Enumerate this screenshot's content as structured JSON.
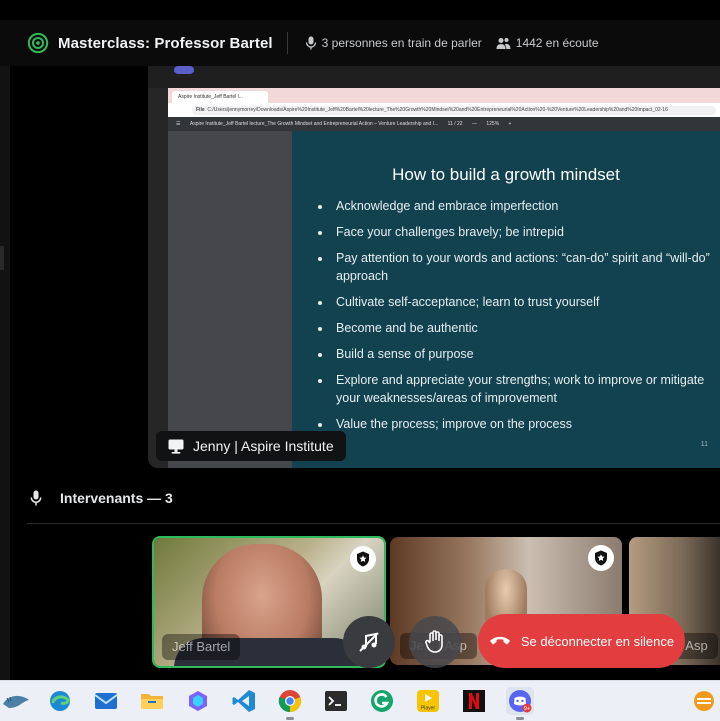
{
  "header": {
    "title": "Masterclass: Professor Bartel",
    "speaking_status": "3 personnes en train de parler",
    "listeners": "1442 en écoute"
  },
  "stream": {
    "browser_tab": "Aspire Institute_Jeff Bartel l...",
    "address_prefix": "File",
    "address": "C:/Users/jennymorrey/Downloads/Aspire%20Institute_Jeff%20Bartel%20lecture_The%20Growth%20Mindset%20and%20Entrepreneurial%20Action%20-%20Venture%20Leadership%20and%20Impact_02-16",
    "pdf_title": "Aspire Institute_Jeff Bartel lecture_The Growth Mindset and Entrepreneurial Action – Venture Leadership and I...",
    "pdf_page": "11 / 22",
    "pdf_zoom": "125%",
    "slide": {
      "title": "How to build a growth mindset",
      "bullets": [
        "Acknowledge and embrace imperfection",
        "Face your challenges bravely; be intrepid",
        "Pay attention to your words and actions: “can-do” spirit and “will-do” approach",
        "Cultivate self-acceptance; learn to trust yourself",
        "Become and be authentic",
        "Build a sense of purpose",
        "Explore and appreciate your strengths; work to improve or mitigate your weaknesses/areas of improvement",
        "Value the process; improve on the process"
      ],
      "page_number": "11"
    },
    "presenter": "Jenny | Aspire Institute"
  },
  "speakers_section": {
    "label": "Intervenants — 3"
  },
  "tiles": [
    {
      "name": "Jeff Bartel"
    },
    {
      "name": "Je... | Asp"
    },
    {
      "name": "| Asp"
    }
  ],
  "controls": {
    "leave_label": "Se déconnecter en silence"
  },
  "taskbar": {
    "player_label": "Player",
    "notif_badge": "9+"
  },
  "colors": {
    "live_green": "#2dbb5d",
    "leave_red": "#e23d3f",
    "slide_bg": "#12424f"
  }
}
